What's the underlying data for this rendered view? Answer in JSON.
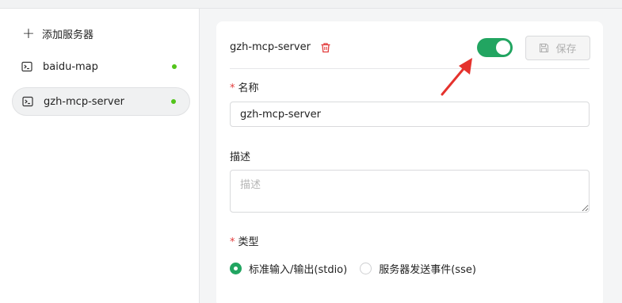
{
  "sidebar": {
    "add_server_label": "添加服务器",
    "items": [
      {
        "label": "baidu-map",
        "status": "online",
        "active": false
      },
      {
        "label": "gzh-mcp-server",
        "status": "online",
        "active": true
      }
    ]
  },
  "detail": {
    "server_title": "gzh-mcp-server",
    "enabled": true,
    "save_label": "保存",
    "name_label": "名称",
    "name_value": "gzh-mcp-server",
    "description_label": "描述",
    "description_placeholder": "描述",
    "type_label": "类型",
    "type_options": [
      {
        "label": "标准输入/输出(stdio)",
        "selected": true
      },
      {
        "label": "服务器发送事件(sse)",
        "selected": false
      }
    ]
  },
  "colors": {
    "accent_green": "#22a561",
    "status_dot": "#52c41a",
    "required_red": "#e23c3c",
    "annotation_arrow": "#e5322d"
  },
  "icons": [
    "plus-icon",
    "terminal-icon",
    "trash-icon",
    "save-icon",
    "annotation-arrow"
  ]
}
